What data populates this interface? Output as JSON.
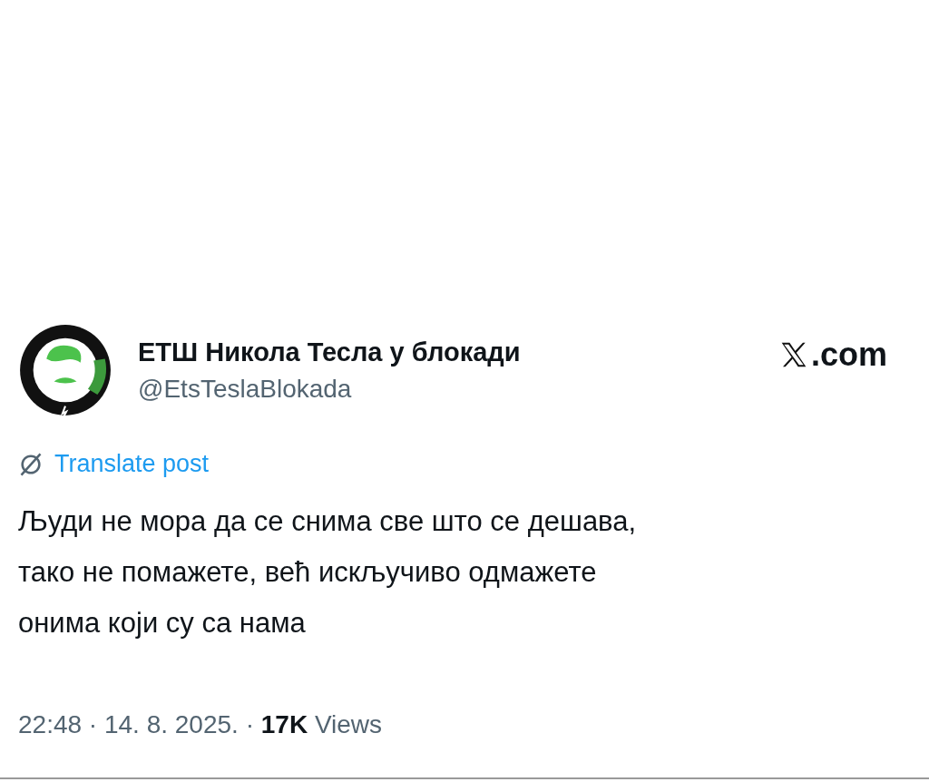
{
  "post": {
    "author_name": "ЕТШ Никола Тесла у блокади",
    "handle": "@EtsTeslaBlokada",
    "source": ".com",
    "translate_link": "Translate post",
    "text_lines": [
      "Људи не мора да се снима све што се дешава,",
      "тако не помажете, већ искључиво одмажете",
      "онима који су са нама"
    ],
    "meta": "22:48 · 14. 8. 2025. · **17K** Views"
  }
}
